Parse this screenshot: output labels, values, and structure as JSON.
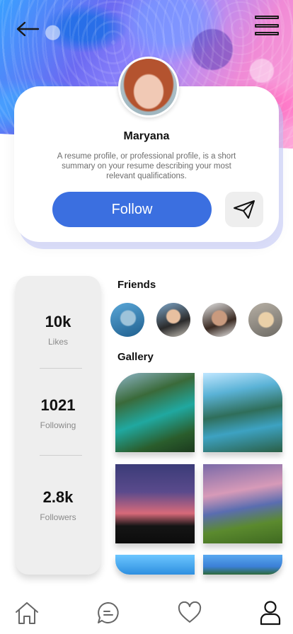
{
  "profile": {
    "name": "Maryana",
    "bio": "A resume profile, or professional profile, is a short summary on your resume describing your most relevant qualifications.",
    "follow_label": "Follow"
  },
  "stats": [
    {
      "value": "10k",
      "label": "Likes"
    },
    {
      "value": "1021",
      "label": "Following"
    },
    {
      "value": "2.8k",
      "label": "Followers"
    }
  ],
  "sections": {
    "friends_title": "Friends",
    "gallery_title": "Gallery"
  },
  "icons": {
    "back": "back-arrow-icon",
    "menu": "menu-icon",
    "send": "paper-plane-icon",
    "nav": [
      "home-icon",
      "chat-icon",
      "heart-icon",
      "profile-icon"
    ]
  },
  "colors": {
    "accent": "#3b6fe0",
    "stats_bg": "#eeeeee"
  }
}
